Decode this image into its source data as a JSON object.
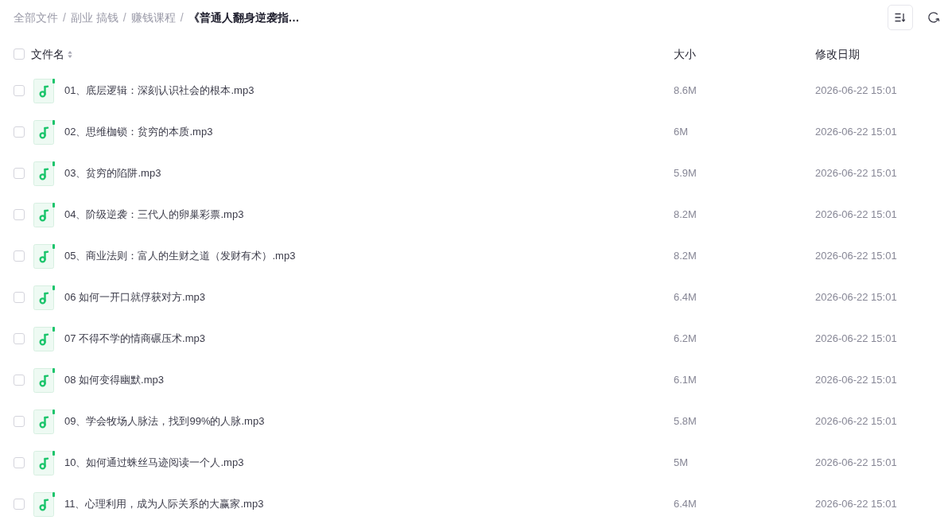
{
  "breadcrumb": [
    {
      "label": "全部文件",
      "separator": "/",
      "current": false
    },
    {
      "label": "副业 搞钱",
      "separator": "/",
      "current": false
    },
    {
      "label": "赚钱课程",
      "separator": "/",
      "current": false
    },
    {
      "label": "《普通人翻身逆袭指…",
      "current": true
    }
  ],
  "table": {
    "select_all": {
      "checked": false
    },
    "columns": [
      {
        "label": "文件名",
        "sortable": true
      },
      {
        "label": "大小",
        "sortable": false
      },
      {
        "label": "修改日期",
        "sortable": false
      }
    ],
    "rows": [
      {
        "checked": false,
        "kind": "audio",
        "name": "01、底层逻辑：深刻认识社会的根本.mp3",
        "size": "8.6M",
        "modified": "2026-06-22 15:01"
      },
      {
        "checked": false,
        "kind": "audio",
        "name": "02、思维枷锁：贫穷的本质.mp3",
        "size": "6M",
        "modified": "2026-06-22 15:01"
      },
      {
        "checked": false,
        "kind": "audio",
        "name": "03、贫穷的陷阱.mp3",
        "size": "5.9M",
        "modified": "2026-06-22 15:01"
      },
      {
        "checked": false,
        "kind": "audio",
        "name": "04、阶级逆袭：三代人的卵巢彩票.mp3",
        "size": "8.2M",
        "modified": "2026-06-22 15:01"
      },
      {
        "checked": false,
        "kind": "audio",
        "name": "05、商业法则：富人的生财之道（发财有术）.mp3",
        "size": "8.2M",
        "modified": "2026-06-22 15:01"
      },
      {
        "checked": false,
        "kind": "audio",
        "name": "06 如何一开口就俘获对方.mp3",
        "size": "6.4M",
        "modified": "2026-06-22 15:01"
      },
      {
        "checked": false,
        "kind": "audio",
        "name": "07 不得不学的情商碾压术.mp3",
        "size": "6.2M",
        "modified": "2026-06-22 15:01"
      },
      {
        "checked": false,
        "kind": "audio",
        "name": "08 如何变得幽默.mp3",
        "size": "6.1M",
        "modified": "2026-06-22 15:01"
      },
      {
        "checked": false,
        "kind": "audio",
        "name": "09、学会牧场人脉法，找到99%的人脉.mp3",
        "size": "5.8M",
        "modified": "2026-06-22 15:01"
      },
      {
        "checked": false,
        "kind": "audio",
        "name": "10、如何通过蛛丝马迹阅读一个人.mp3",
        "size": "5M",
        "modified": "2026-06-22 15:01"
      },
      {
        "checked": false,
        "kind": "audio",
        "name": "11、心理利用，成为人际关系的大赢家.mp3",
        "size": "6.4M",
        "modified": "2026-06-22 15:01"
      }
    ]
  }
}
